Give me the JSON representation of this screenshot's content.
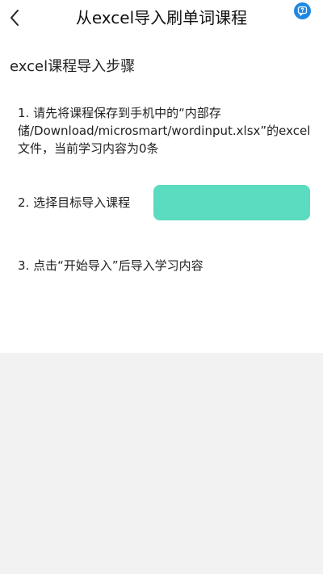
{
  "header": {
    "title": "从excel导入刷单词课程",
    "back_icon": "chevron-left-icon",
    "help_icon": "help-chat-icon",
    "help_color": "#1e88e5"
  },
  "main": {
    "section_title": "excel课程导入步骤",
    "steps": [
      {
        "text": "1. 请先将课程保存到手机中的“内部存储/Download/microsmart/wordinput.xlsx”的excel文件，当前学习内容为0条"
      },
      {
        "text": "2. 选择目标导入课程"
      },
      {
        "text": "3. 点击“开始导入”后导入学习内容"
      }
    ],
    "course_select": {
      "value": "",
      "color": "#5bdbbf"
    }
  }
}
